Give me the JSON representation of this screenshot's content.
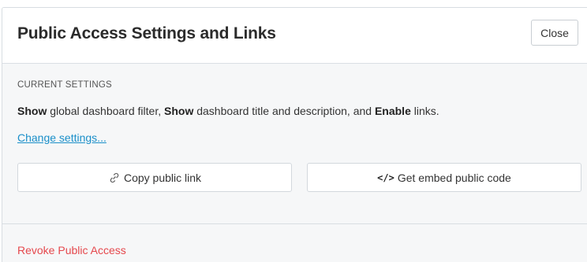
{
  "dialog": {
    "title": "Public Access Settings and Links",
    "close_label": "Close"
  },
  "settings": {
    "section_label": "CURRENT SETTINGS",
    "summary": {
      "word1": "Show",
      "text1": " global dashboard filter, ",
      "word2": "Show",
      "text2": " dashboard title and description, and ",
      "word3": "Enable",
      "text3": " links."
    },
    "change_link": "Change settings..."
  },
  "actions": {
    "copy_label": "Copy public link",
    "copy_icon": "link-icon",
    "embed_label": "Get embed public code",
    "embed_icon": "code-icon"
  },
  "footer": {
    "revoke_label": "Revoke Public Access",
    "revoke_color": "#e5484d"
  },
  "colors": {
    "link": "#1a8fc9",
    "panel_bg": "#f6f7f8"
  }
}
